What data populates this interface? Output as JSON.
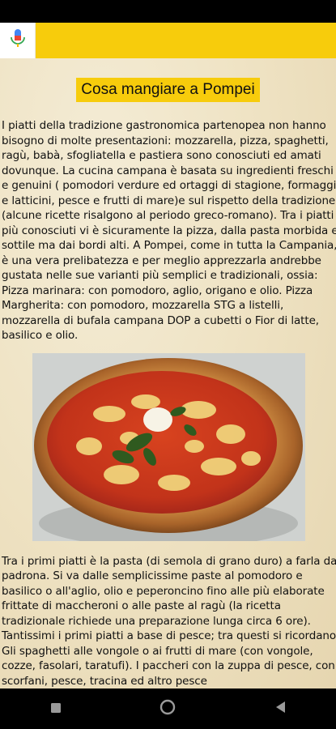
{
  "header": {
    "mic_icon": "microphone-icon",
    "accent": "#f7cc0c"
  },
  "article": {
    "title": "Cosa mangiare a Pompei",
    "paragraph_1": "I piatti della tradizione gastronomica partenopea non hanno bisogno di molte presentazioni: mozzarella, pizza, spaghetti, ragù, babà, sfogliatella e pastiera sono conosciuti ed amati dovunque. La cucina campana è basata su ingredienti freschi e genuini ( pomodori verdure ed ortaggi di stagione, formaggi e latticini, pesce e frutti di mare)e sul rispetto della tradizione (alcune ricette risalgono al periodo greco-romano). Tra i piatti più conosciuti vi è sicuramente la pizza, dalla pasta morbida e sottile ma dai bordi alti. A Pompei, come in tutta la Campania, è una vera prelibatezza e per meglio apprezzarla andrebbe gustata nelle sue varianti più semplici e tradizionali, ossia: Pizza marinara: con pomodoro, aglio, origano e olio. Pizza Margherita: con pomodoro, mozzarella STG a listelli, mozzarella di bufala campana DOP a cubetti o Fior di latte, basilico e olio.",
    "image_subject": "pizza-margherita",
    "paragraph_2": "Tra i primi piatti è la pasta (di semola di grano duro) a farla da padrona. Si va dalle semplicissime paste al pomodoro e basilico o all'aglio, olio e peperoncino fino alle più elaborate frittate di maccheroni o alle paste al ragù (la ricetta tradizionale richiede una preparazione lunga circa 6 ore). Tantissimi i primi piatti a base di pesce; tra questi si ricordano: Gli spaghetti alle vongole o ai frutti di mare (con vongole, cozze, fasolari, taratufi). I paccheri con la zuppa di pesce, con scorfani, pesce, tracina ed altro pesce"
  },
  "navigation": {
    "recents_icon": "square-recents-icon",
    "home_icon": "circle-home-icon",
    "back_icon": "triangle-back-icon"
  }
}
